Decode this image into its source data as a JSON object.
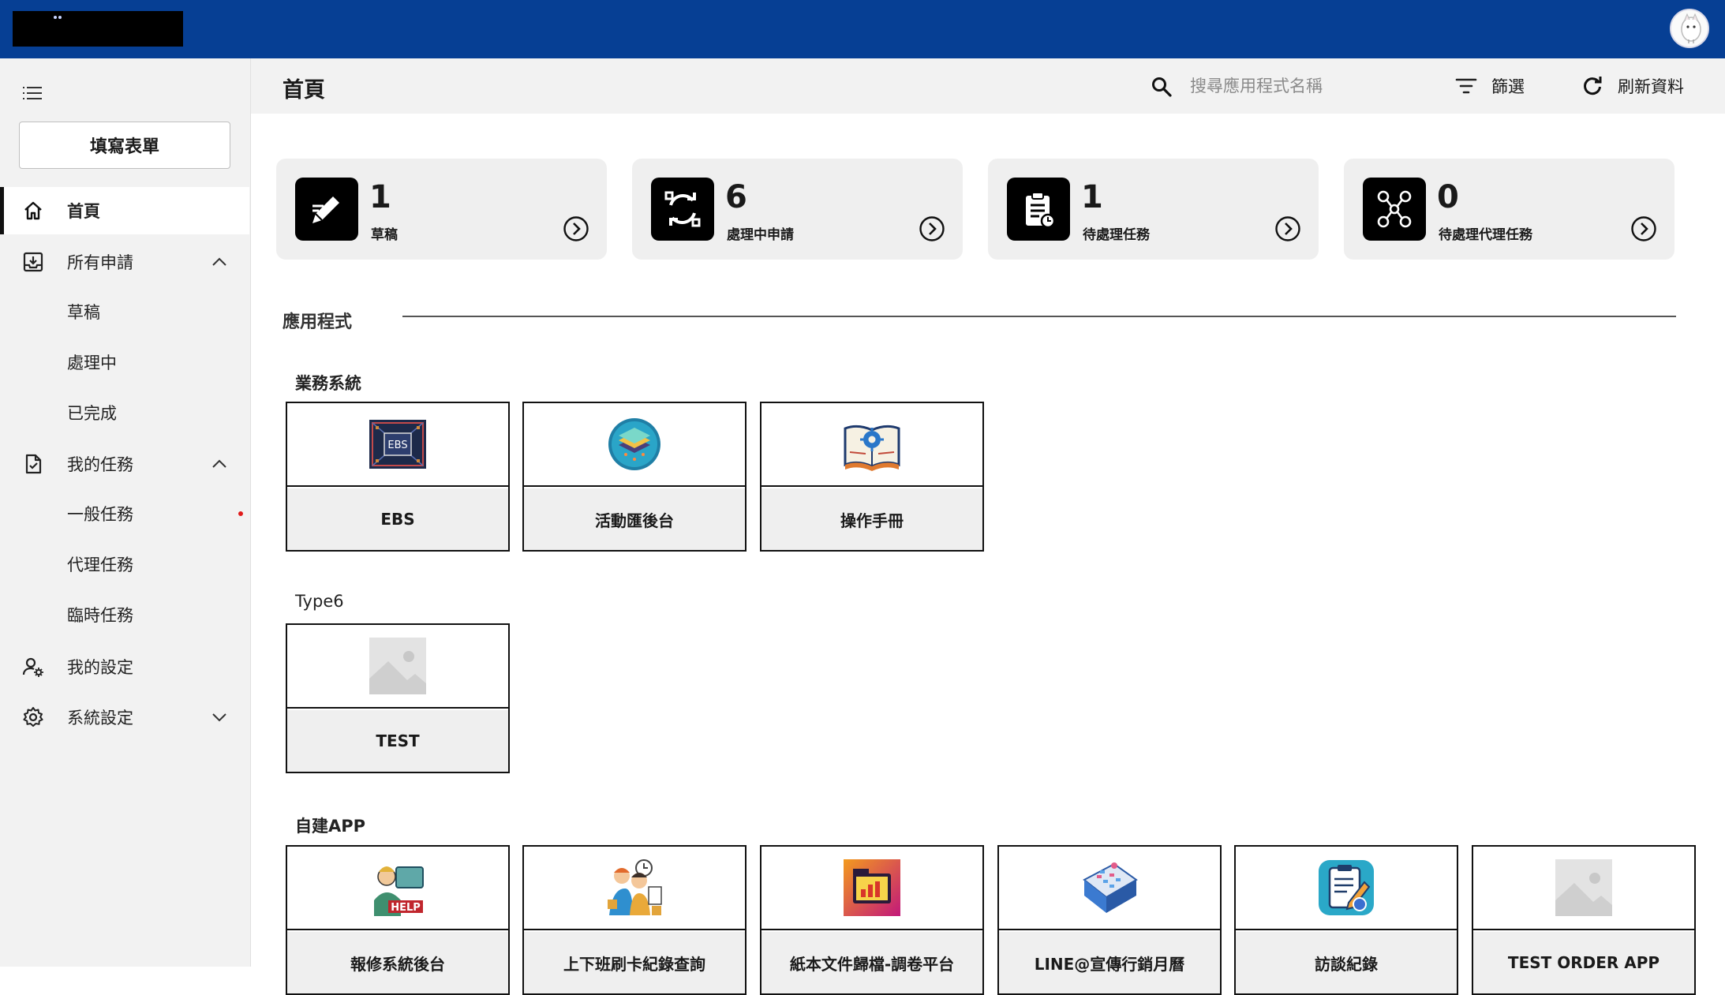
{
  "colors": {
    "topbar": "#063f94",
    "sidebar_bg": "#f2f2f2",
    "card_bg": "#efefef",
    "alert_dot": "#e01b1b"
  },
  "sidebar": {
    "fill_form_label": "填寫表單",
    "items": [
      {
        "label": "首頁",
        "icon": "home-icon",
        "active": true
      },
      {
        "label": "所有申請",
        "icon": "inbox-download-icon",
        "expanded": true,
        "children": [
          {
            "label": "草稿"
          },
          {
            "label": "處理中"
          },
          {
            "label": "已完成"
          }
        ]
      },
      {
        "label": "我的任務",
        "icon": "task-document-icon",
        "expanded": true,
        "children": [
          {
            "label": "一般任務",
            "has_alert": true
          },
          {
            "label": "代理任務"
          },
          {
            "label": "臨時任務"
          }
        ]
      },
      {
        "label": "我的設定",
        "icon": "user-settings-icon"
      },
      {
        "label": "系統設定",
        "icon": "gear-icon",
        "expanded": false
      }
    ]
  },
  "header": {
    "title": "首頁",
    "search_placeholder": "搜尋應用程式名稱",
    "filter_label": "篩選",
    "refresh_label": "刷新資料"
  },
  "stats": [
    {
      "count": "1",
      "label": "草稿",
      "icon": "pencil-note-icon"
    },
    {
      "count": "6",
      "label": "處理中申請",
      "icon": "sync-arrows-icon"
    },
    {
      "count": "1",
      "label": "待處理任務",
      "icon": "clipboard-clock-icon"
    },
    {
      "count": "0",
      "label": "待處理代理任務",
      "icon": "people-network-icon"
    }
  ],
  "apps": {
    "heading": "應用程式",
    "groups": [
      {
        "title": "業務系統",
        "items": [
          {
            "name": "EBS",
            "icon": "ebs-chip-icon"
          },
          {
            "name": "活動匯後台",
            "icon": "server-stack-icon"
          },
          {
            "name": "操作手冊",
            "icon": "manual-book-icon"
          }
        ]
      },
      {
        "title": "Type6",
        "items": [
          {
            "name": "TEST",
            "icon": "image-placeholder-icon"
          }
        ]
      },
      {
        "title": "自建APP",
        "items": [
          {
            "name": "報修系統後台",
            "icon": "help-desk-icon"
          },
          {
            "name": "上下班刷卡紀錄查詢",
            "icon": "clock-in-icon"
          },
          {
            "name": "紙本文件歸檔-調卷平台",
            "icon": "archive-folder-icon"
          },
          {
            "name": "LINE@宣傳行銷月曆",
            "icon": "calendar-icon"
          },
          {
            "name": "訪談紀錄",
            "icon": "interview-clipboard-icon"
          },
          {
            "name": "TEST ORDER APP",
            "icon": "image-placeholder-icon"
          }
        ]
      }
    ]
  }
}
